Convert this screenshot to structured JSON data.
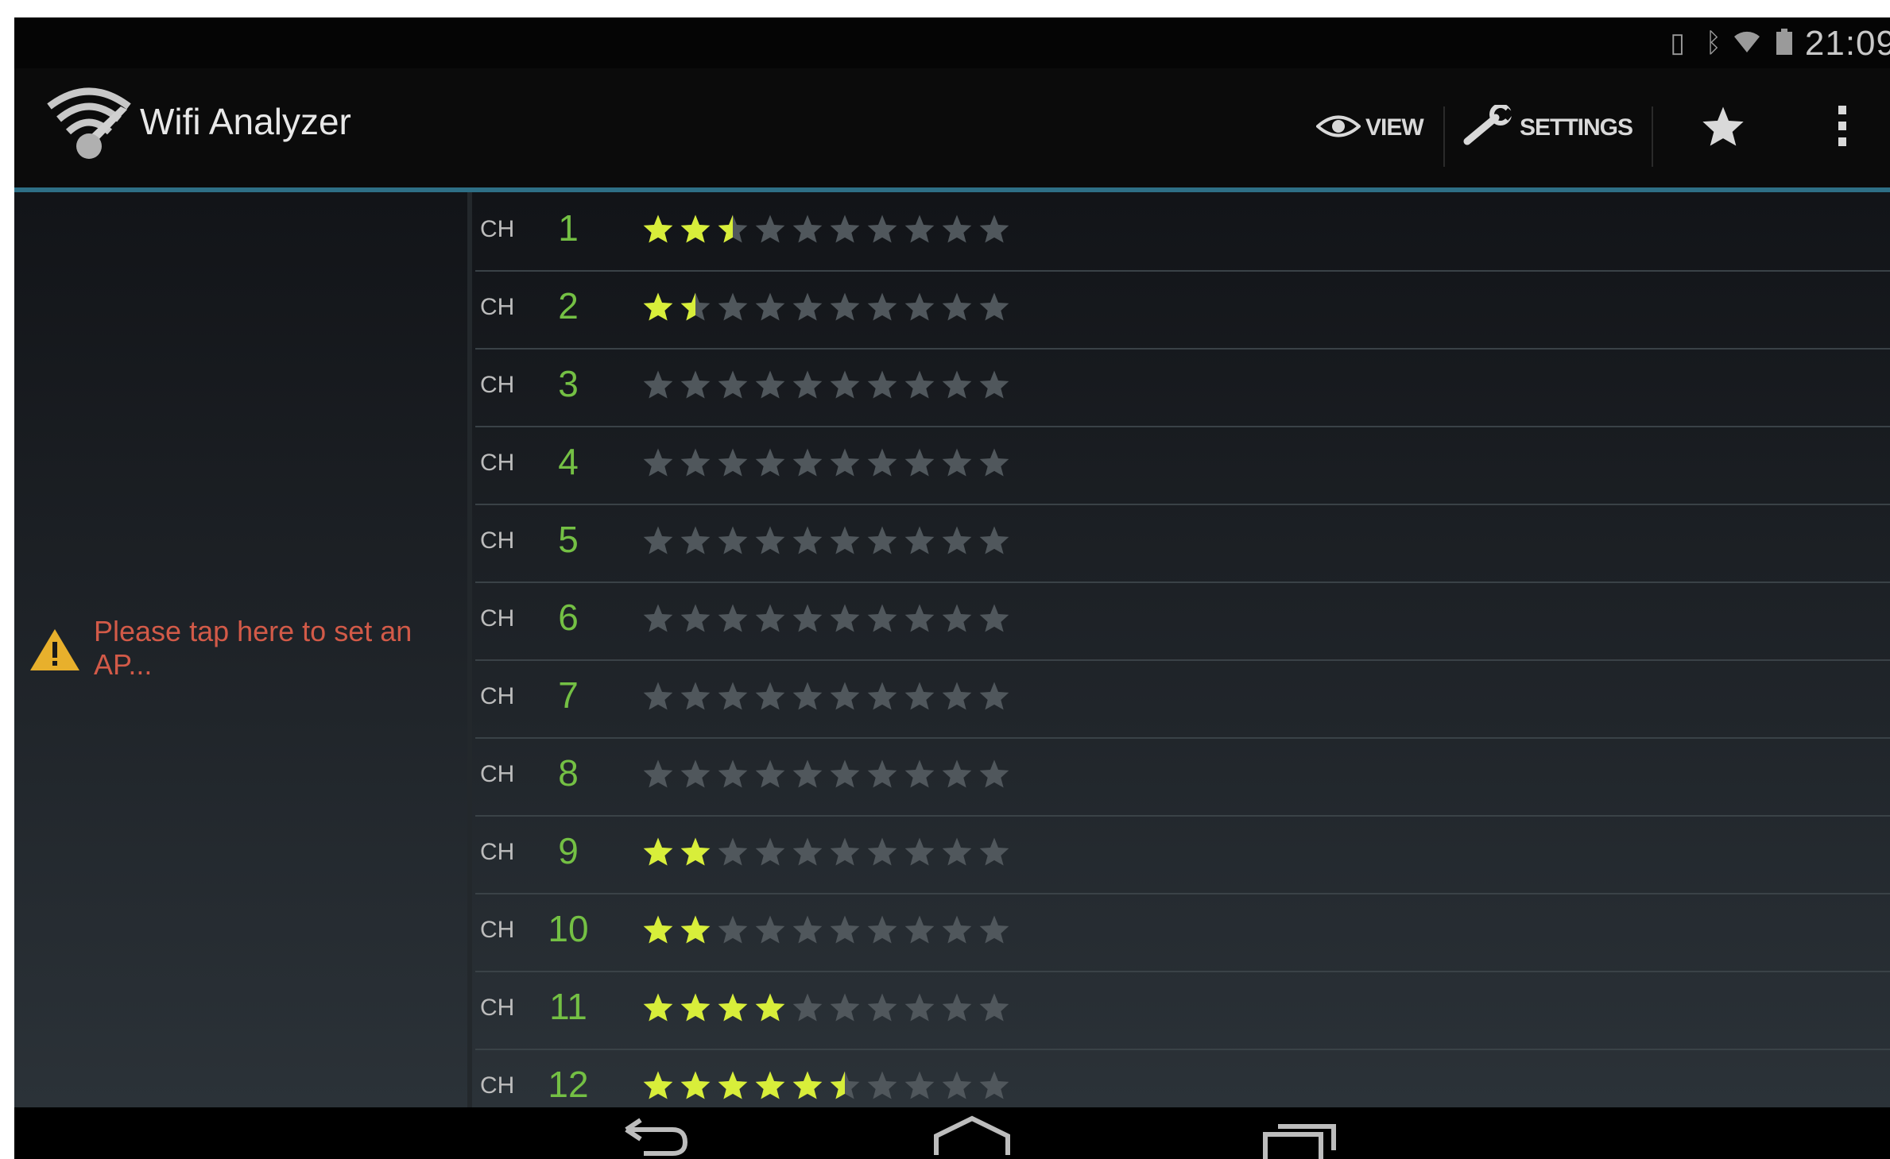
{
  "status_bar": {
    "time": "21:09",
    "icons": [
      "vibrate-icon",
      "bluetooth-icon",
      "wifi-signal-icon",
      "battery-icon"
    ]
  },
  "action_bar": {
    "title": "Wifi Analyzer",
    "app_icon": "wifi-analyzer-logo-icon",
    "view_label": "VIEW",
    "view_icon": "eye-icon",
    "settings_label": "SETTINGS",
    "settings_icon": "wrench-icon",
    "favorite_icon": "star-icon",
    "overflow_icon": "overflow-menu-icon"
  },
  "ap_panel": {
    "warning_icon": "warning-icon",
    "message": "Please tap here to set an AP..."
  },
  "channel_label": "CH",
  "max_rating": 10,
  "channels": [
    {
      "number": "1",
      "rating": 2.5
    },
    {
      "number": "2",
      "rating": 1.5
    },
    {
      "number": "3",
      "rating": 0
    },
    {
      "number": "4",
      "rating": 0
    },
    {
      "number": "5",
      "rating": 0
    },
    {
      "number": "6",
      "rating": 0
    },
    {
      "number": "7",
      "rating": 0
    },
    {
      "number": "8",
      "rating": 0
    },
    {
      "number": "9",
      "rating": 2
    },
    {
      "number": "10",
      "rating": 2
    },
    {
      "number": "11",
      "rating": 4
    },
    {
      "number": "12",
      "rating": 5.5
    }
  ],
  "colors": {
    "star_active": "#d8ee3a",
    "star_inactive": "#50575c",
    "channel_number": "#74c044",
    "warning_text": "#d25a48",
    "accent_line": "#2e6f86"
  },
  "nav_bar": {
    "icons": [
      "back-icon",
      "home-icon",
      "recent-apps-icon"
    ]
  }
}
